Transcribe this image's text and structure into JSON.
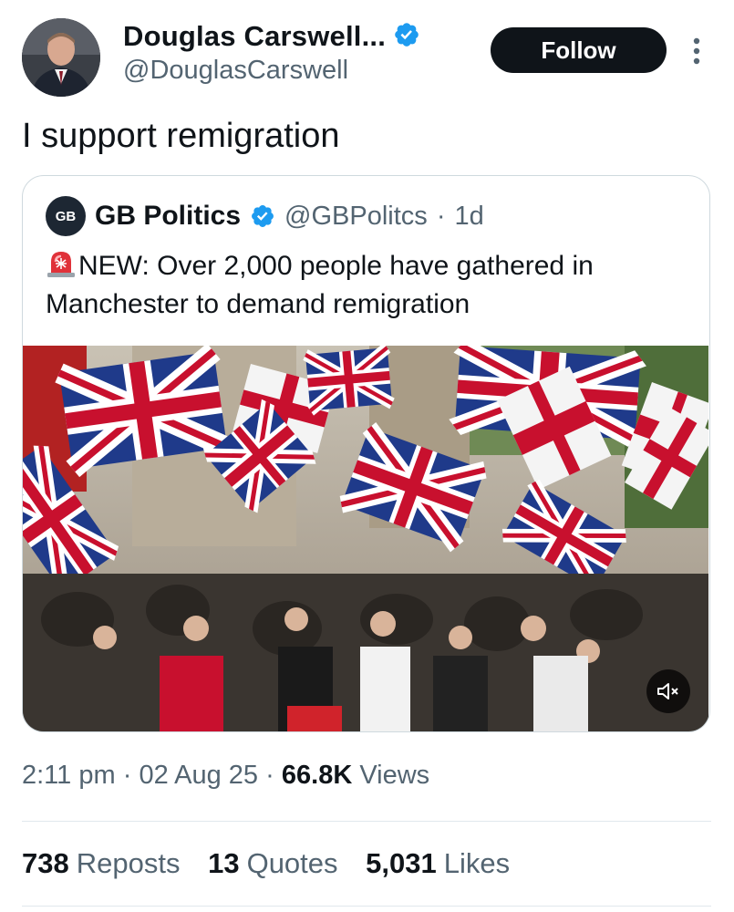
{
  "author": {
    "display_name": "Douglas Carswell...",
    "handle": "@DouglasCarswell",
    "verified": true,
    "avatar_icon": "person-portrait"
  },
  "follow_label": "Follow",
  "more_icon": "vertical-ellipsis-icon",
  "tweet": {
    "text": "I support remigration"
  },
  "quote": {
    "avatar_text": "GB",
    "display_name": "GB Politics",
    "handle": "@GBPolitcs",
    "separator": "·",
    "time": "1d",
    "siren_icon": "rotating-light-emoji",
    "text": "NEW: Over 2,000 people have gathered in Manchester to demand remigration",
    "media": {
      "type": "video",
      "mute_icon": "speaker-muted-icon"
    }
  },
  "meta": {
    "time": "2:11 pm",
    "sep1": "·",
    "date": "02 Aug 25",
    "sep2": "·",
    "views_count": "66.8K",
    "views_label": "Views"
  },
  "stats": [
    {
      "count": "738",
      "label": "Reposts"
    },
    {
      "count": "13",
      "label": "Quotes"
    },
    {
      "count": "5,031",
      "label": "Likes"
    }
  ],
  "colors": {
    "verified_blue": "#1d9bf0",
    "text_primary": "#0f1419",
    "text_secondary": "#536471",
    "border": "#cfd9de",
    "follow_bg": "#0f1419"
  }
}
